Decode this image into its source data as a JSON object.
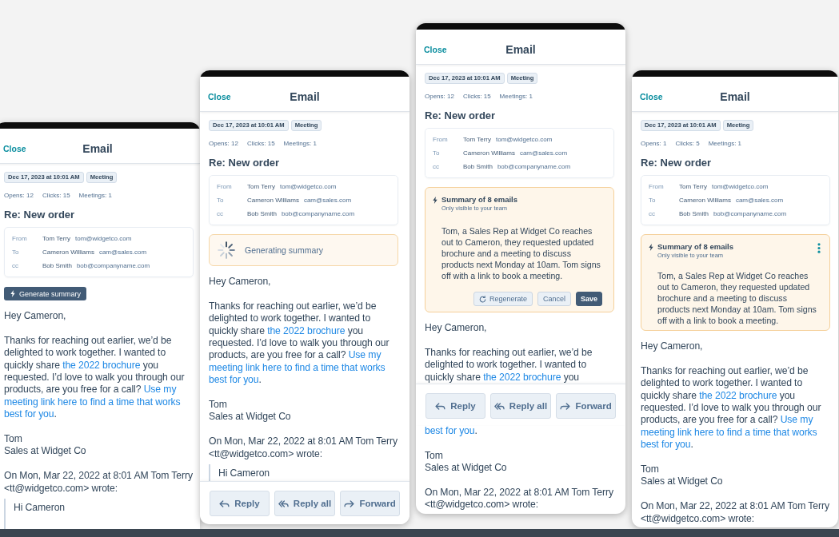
{
  "phones": [
    {
      "header": {
        "close": "Close",
        "title": "Email"
      },
      "date": "Dec 17, 2023 at 10:01 AM",
      "tag": "Meeting",
      "stats": [
        "Opens: 12",
        "Clicks: 15",
        "Meetings: 1"
      ],
      "subject": "Re: New order",
      "recipients": [
        {
          "label": "From",
          "name": "Tom Terry",
          "email": "tom@widgetco.com"
        },
        {
          "label": "To",
          "name": "Cameron Williams",
          "email": "cam@sales.com"
        },
        {
          "label": "cc",
          "name": "Bob Smith",
          "email": "bob@companyname.com"
        }
      ],
      "summary": {
        "kind": "button",
        "label": "Generate summary"
      },
      "blocks": [
        {
          "kind": "greeting",
          "text": "Hey Cameron,"
        },
        {
          "kind": "paragraph",
          "parts": [
            {
              "kind": "text",
              "text": "Thanks for reaching out earlier, we’d be delighted to work together. I wanted to quickly share "
            },
            {
              "kind": "link",
              "lines": [
                "the 2022 brochure"
              ]
            },
            {
              "kind": "text",
              "text": " you requested. I’d love to walk you through our products, are you free for a call? "
            },
            {
              "kind": "link",
              "lines": [
                "Use my",
                "meeting link here to find a time that works",
                "best for you"
              ]
            },
            {
              "kind": "text",
              "text": "."
            }
          ]
        },
        {
          "kind": "signature",
          "lines": [
            "Tom",
            "Sales at Widget Co"
          ]
        },
        {
          "kind": "attribution",
          "text": "On Mon, Mar 22, 2022 at 8:01 AM Tom Terry <tt@widgetco.com> wrote:"
        },
        {
          "kind": "quote",
          "lines": [
            "Hi Cameron"
          ]
        }
      ]
    },
    {
      "header": {
        "close": "Close",
        "title": "Email"
      },
      "date": "Dec 17, 2023 at 10:01 AM",
      "tag": "Meeting",
      "stats": [
        "Opens: 12",
        "Clicks: 15",
        "Meetings: 1"
      ],
      "subject": "Re: New order",
      "recipients": [
        {
          "label": "From",
          "name": "Tom Terry",
          "email": "tom@widgetco.com"
        },
        {
          "label": "To",
          "name": "Cameron Williams",
          "email": "cam@sales.com"
        },
        {
          "label": "cc",
          "name": "Bob Smith",
          "email": "bob@companyname.com"
        }
      ],
      "summary": {
        "kind": "loading",
        "label": "Generating summary"
      },
      "blocks": [
        {
          "kind": "greeting",
          "text": "Hey Cameron,"
        },
        {
          "kind": "paragraph",
          "parts": [
            {
              "kind": "text",
              "text": "Thanks for reaching out earlier, we’d be delighted to work together. I wanted to quickly share "
            },
            {
              "kind": "link",
              "lines": [
                "the 2022 brochure"
              ]
            },
            {
              "kind": "text",
              "text": " you requested. I’d love to walk you through our products, are you free for a call? "
            },
            {
              "kind": "link",
              "lines": [
                "Use my",
                "meeting link here to find a time that works",
                "best for you"
              ]
            },
            {
              "kind": "text",
              "text": "."
            }
          ]
        },
        {
          "kind": "signature",
          "lines": [
            "Tom",
            "Sales at Widget Co"
          ]
        },
        {
          "kind": "attribution",
          "text": "On Mon, Mar 22, 2022 at 8:01 AM Tom Terry <tt@widgetco.com> wrote:"
        },
        {
          "kind": "quote",
          "lines": [
            "Hi Cameron"
          ]
        },
        {
          "kind": "actions",
          "buttons": [
            {
              "kind": "reply",
              "label": "Reply"
            },
            {
              "kind": "reply_all",
              "label": "Reply all"
            },
            {
              "kind": "forward",
              "label": "Forward"
            }
          ]
        }
      ]
    },
    {
      "header": {
        "close": "Close",
        "title": "Email"
      },
      "date": "Dec 17, 2023 at 10:01 AM",
      "tag": "Meeting",
      "stats": [
        "Opens: 12",
        "Clicks: 15",
        "Meetings: 1"
      ],
      "subject": "Re: New order",
      "recipients": [
        {
          "label": "From",
          "name": "Tom Terry",
          "email": "tom@widgetco.com"
        },
        {
          "label": "To",
          "name": "Cameron Williams",
          "email": "cam@sales.com"
        },
        {
          "label": "cc",
          "name": "Bob Smith",
          "email": "bob@companyname.com"
        }
      ],
      "summary": {
        "kind": "editing",
        "title": "Summary of 8 emails",
        "note": "Only visible to your team",
        "text": "Tom, a Sales Rep at Widget Co reaches out to Cameron, they requested updated brochure and a meeting to discuss products next Monday at 10am. Tom signs off with a link to book a meeting.",
        "buttons": [
          {
            "kind": "regenerate",
            "label": "Regenerate"
          },
          {
            "kind": "cancel",
            "label": "Cancel"
          },
          {
            "kind": "save",
            "label": "Save"
          }
        ]
      },
      "blocks": [
        {
          "kind": "greeting",
          "text": "Hey Cameron,"
        },
        {
          "kind": "paragraph",
          "parts": [
            {
              "kind": "text",
              "text": "Thanks for reaching out earlier, we’d be delighted to work together. I wanted to quickly share "
            },
            {
              "kind": "link",
              "lines": [
                "the 2022 brochure"
              ]
            },
            {
              "kind": "text",
              "text": " you"
            }
          ]
        },
        {
          "kind": "actions",
          "buttons": [
            {
              "kind": "reply",
              "label": "Reply"
            },
            {
              "kind": "reply_all",
              "label": "Reply all"
            },
            {
              "kind": "forward",
              "label": "Forward"
            }
          ]
        },
        {
          "kind": "paragraph",
          "parts": [
            {
              "kind": "link",
              "lines": [
                "best for you"
              ]
            },
            {
              "kind": "text",
              "text": "."
            }
          ]
        },
        {
          "kind": "signature",
          "lines": [
            "Tom",
            "Sales at Widget Co"
          ]
        },
        {
          "kind": "attribution",
          "text": "On Mon, Mar 22, 2022 at 8:01 AM Tom Terry <tt@widgetco.com> wrote:"
        }
      ]
    },
    {
      "header": {
        "close": "Close",
        "title": "Email"
      },
      "date": "Dec 17, 2023 at 10:01 AM",
      "tag": "Meeting",
      "stats": [
        "Opens: 1",
        "Clicks: 5",
        "Meetings: 1"
      ],
      "subject": "Re: New order",
      "recipients": [
        {
          "label": "From",
          "name": "Tom Terry",
          "email": "tom@widgetco.com"
        },
        {
          "label": "To",
          "name": "Cameron Williams",
          "email": "cam@sales.com"
        },
        {
          "label": "cc",
          "name": "Bob Smith",
          "email": "bob@companyname.com"
        }
      ],
      "summary": {
        "kind": "saved",
        "title": "Summary of 8 emails",
        "note": "Only visible to your team",
        "text": "Tom, a Sales Rep at Widget Co reaches out to Cameron, they requested updated brochure and a meeting to discuss products next Monday at 10am. Tom signs off with a link to book a meeting."
      },
      "blocks": [
        {
          "kind": "greeting",
          "text": "Hey Cameron,"
        },
        {
          "kind": "paragraph",
          "parts": [
            {
              "kind": "text",
              "text": "Thanks for reaching out earlier, we’d be delighted to work together. I wanted to quickly share "
            },
            {
              "kind": "link",
              "lines": [
                "the 2022 brochure"
              ]
            },
            {
              "kind": "text",
              "text": " you requested. I’d love to walk you through our products, are you free for a call? "
            },
            {
              "kind": "link",
              "lines": [
                "Use my",
                "meeting link here to find a time that works",
                "best for you"
              ]
            },
            {
              "kind": "text",
              "text": "."
            }
          ]
        },
        {
          "kind": "signature",
          "lines": [
            "Tom",
            "Sales at Widget Co"
          ]
        },
        {
          "kind": "attribution",
          "text": "On Mon, Mar 22, 2022 at 8:01 AM Tom Terry <tt@widgetco.com> wrote:"
        }
      ]
    }
  ]
}
